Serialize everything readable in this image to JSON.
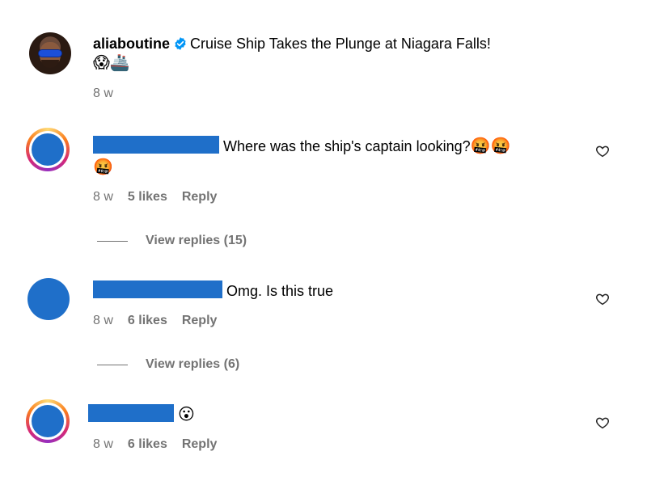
{
  "post": {
    "username": "aliaboutine",
    "caption": "Cruise Ship Takes the Plunge at Niagara Falls!",
    "caption_emojis": "😱🚢",
    "time": "8 w"
  },
  "comments": [
    {
      "text": "Where was the ship's captain looking?",
      "emojis": "🤬🤬",
      "emojis_line2": "🤬",
      "time": "8 w",
      "likes": "5 likes",
      "reply": "Reply",
      "view_replies": "View replies (15)"
    },
    {
      "text": "Omg. Is this true",
      "time": "8 w",
      "likes": "6 likes",
      "reply": "Reply",
      "view_replies": "View replies (6)"
    },
    {
      "emojis": "😮",
      "time": "8 w",
      "likes": "6 likes",
      "reply": "Reply"
    }
  ],
  "colors": {
    "redaction": "#1f6fc9",
    "muted_text": "#737373",
    "verified": "#0095f6"
  }
}
